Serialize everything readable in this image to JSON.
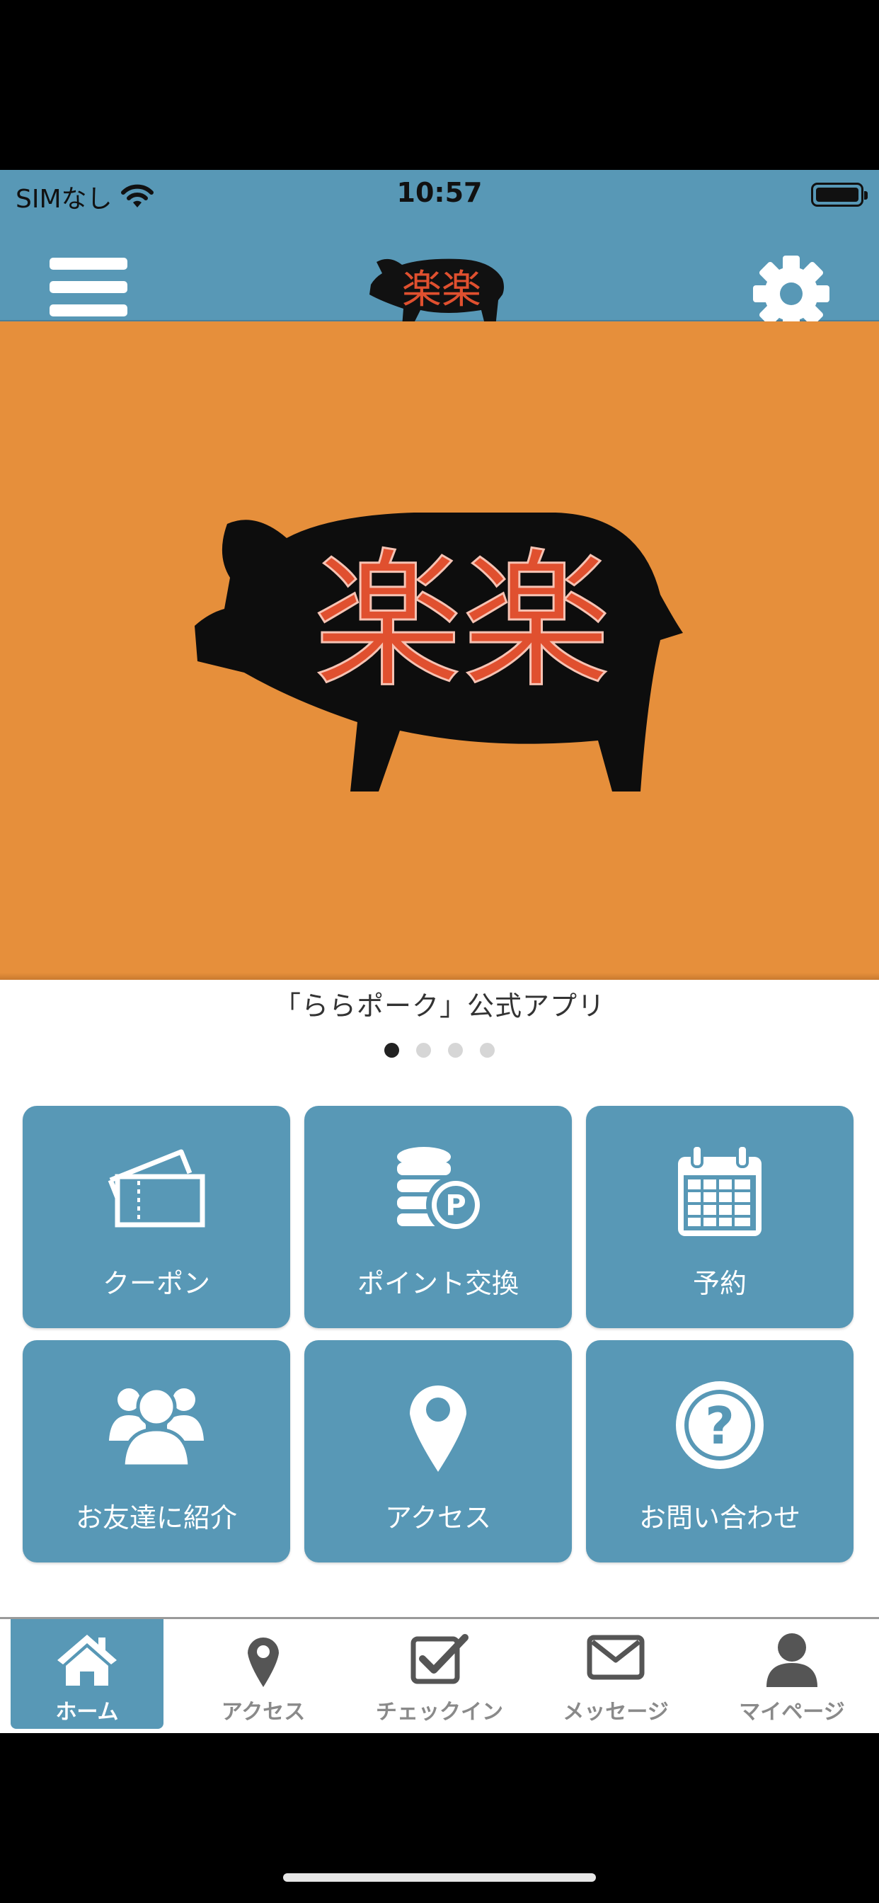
{
  "status_bar": {
    "carrier": "SIMなし",
    "time": "10:57"
  },
  "header": {
    "menu_icon": "hamburger-icon",
    "settings_icon": "gear-icon",
    "logo_text": "楽楽"
  },
  "hero": {
    "logo_text": "楽楽",
    "caption": "「ららポーク」公式アプリ",
    "slide_count": 4,
    "active_slide": 1
  },
  "tiles": [
    {
      "label": "クーポン",
      "icon": "ticket-icon"
    },
    {
      "label": "ポイント交換",
      "icon": "coins-icon"
    },
    {
      "label": "予約",
      "icon": "calendar-icon"
    },
    {
      "label": "お友達に紹介",
      "icon": "users-icon"
    },
    {
      "label": "アクセス",
      "icon": "map-pin-icon"
    },
    {
      "label": "お問い合わせ",
      "icon": "question-icon"
    }
  ],
  "tabbar": [
    {
      "label": "ホーム",
      "icon": "home-icon",
      "active": true
    },
    {
      "label": "アクセス",
      "icon": "map-pin-icon",
      "active": false
    },
    {
      "label": "チェックイン",
      "icon": "checkbox-icon",
      "active": false
    },
    {
      "label": "メッセージ",
      "icon": "envelope-icon",
      "active": false
    },
    {
      "label": "マイページ",
      "icon": "person-icon",
      "active": false
    }
  ],
  "colors": {
    "header": "#5898b6",
    "hero_bg": "#e68f3b",
    "tile": "#5898b6",
    "logo_text": "#e0502f"
  }
}
